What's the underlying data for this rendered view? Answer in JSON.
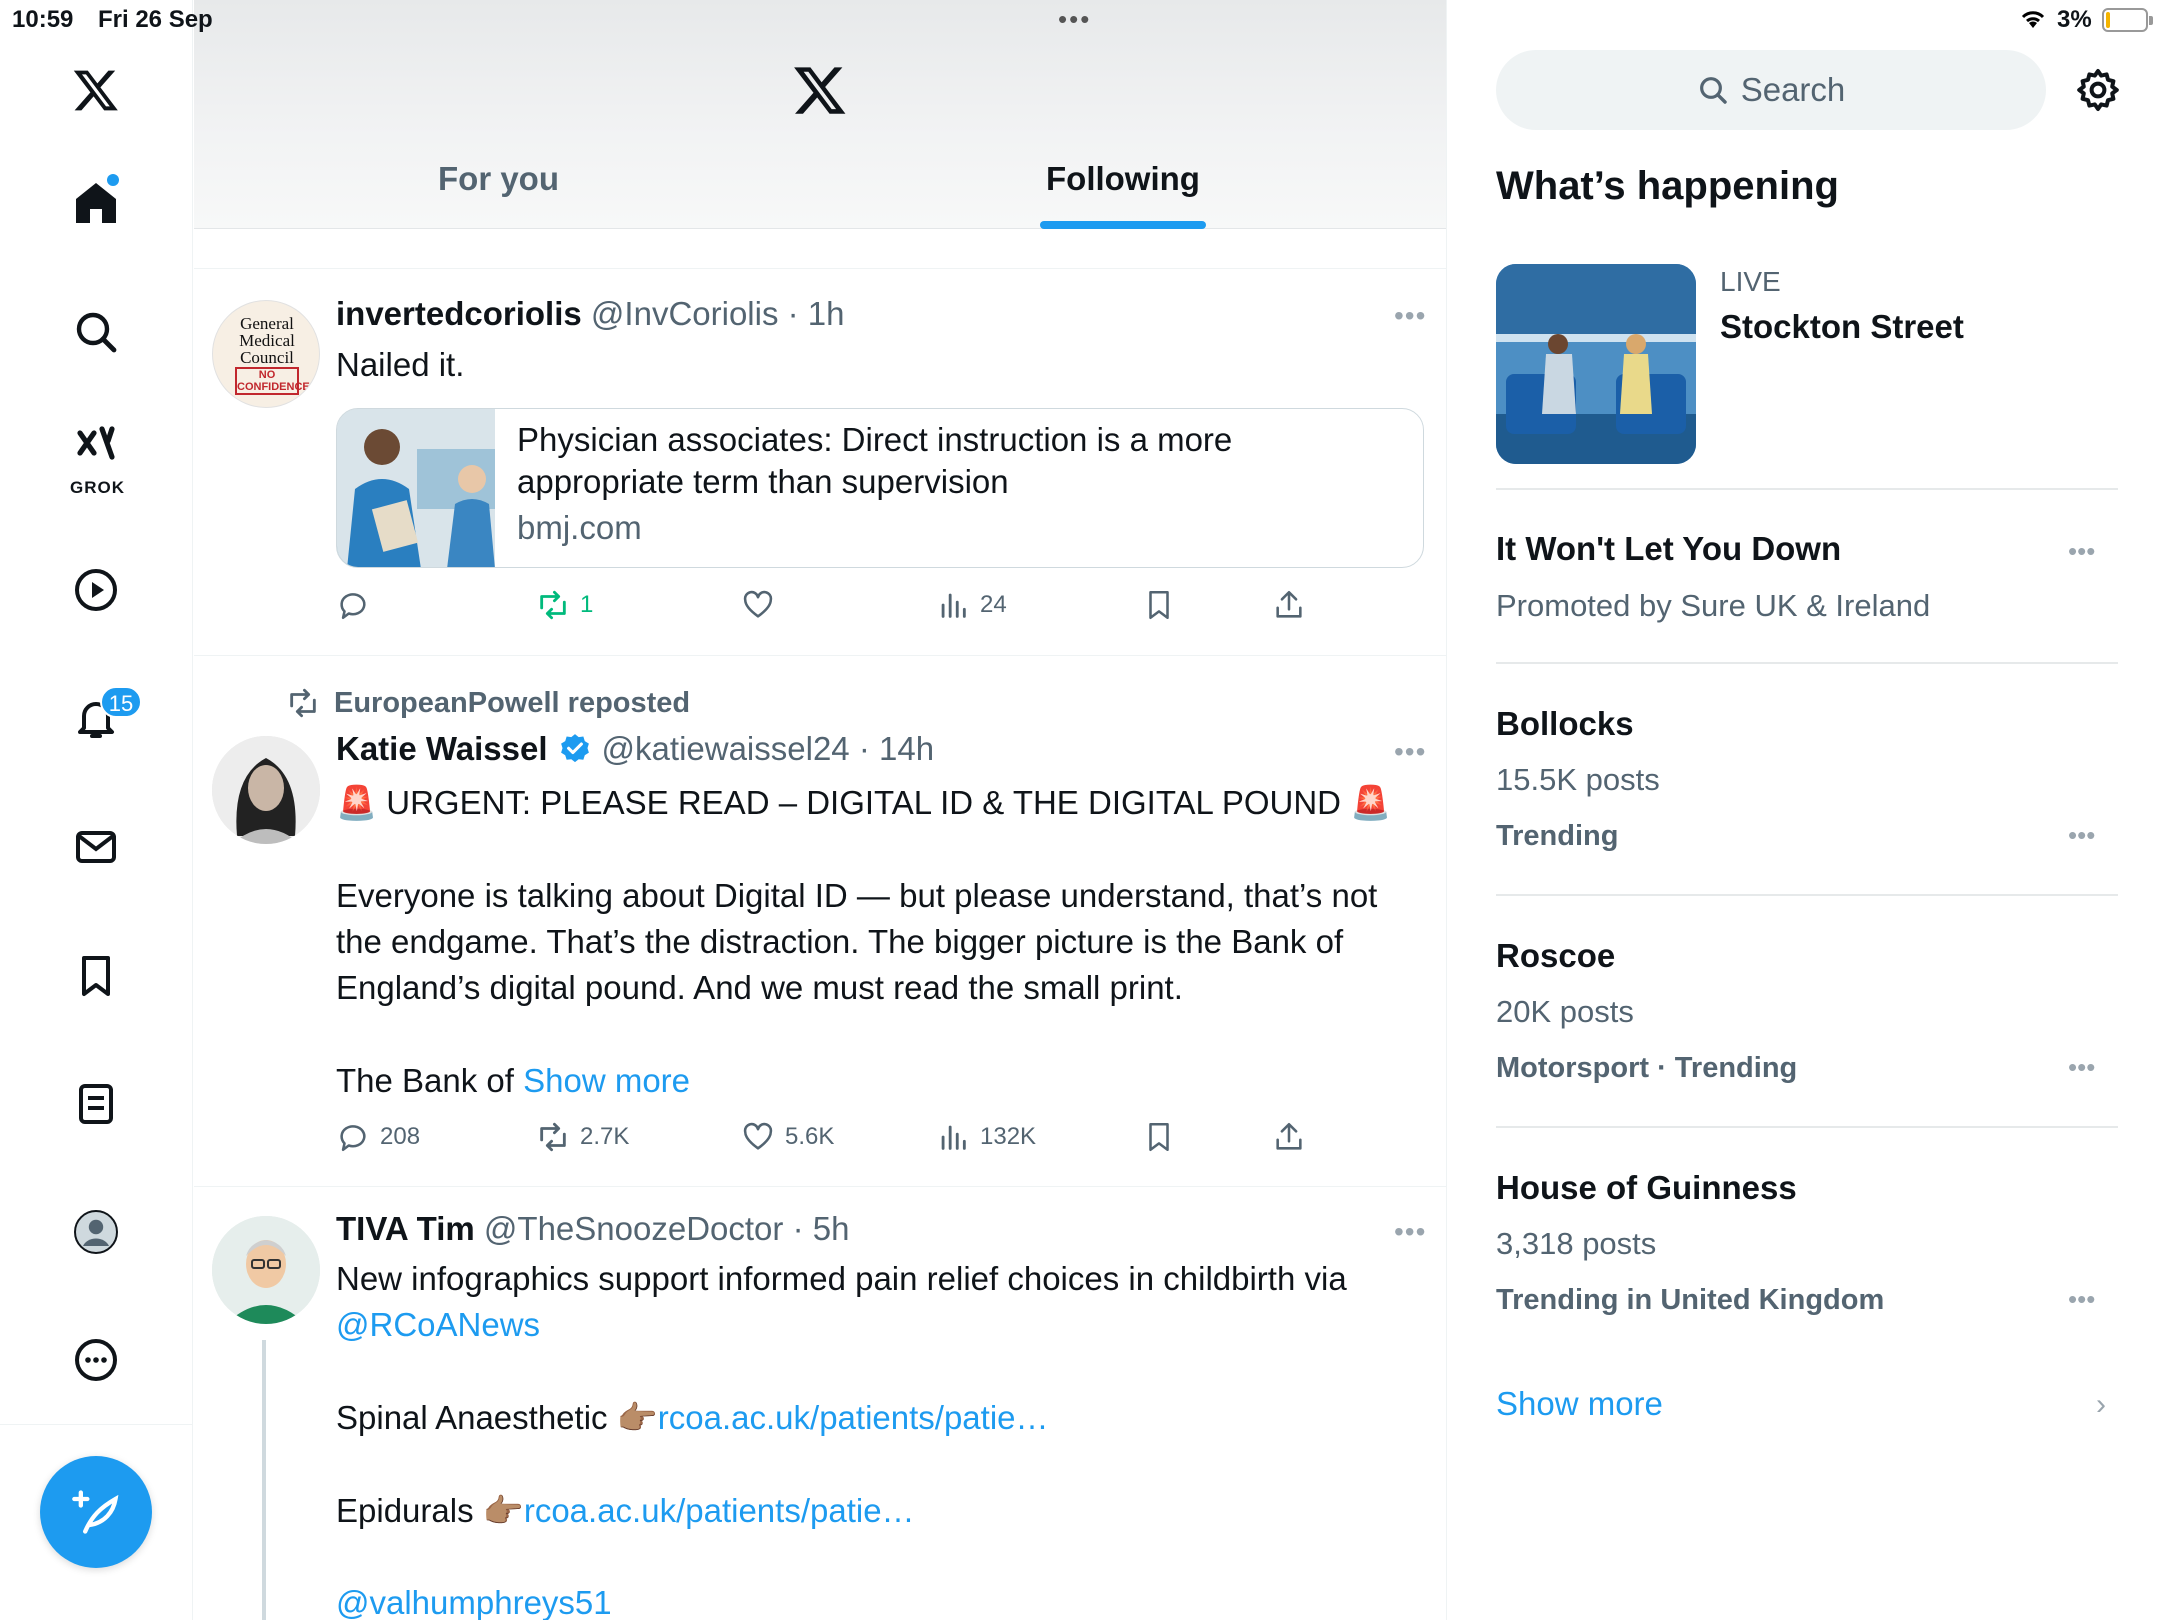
{
  "status": {
    "time": "10:59",
    "date": "Fri 26 Sep",
    "battery": "3%"
  },
  "nav": {
    "grok_label": "GROK",
    "notifications_badge": "15"
  },
  "tabs": {
    "for_you": "For you",
    "following": "Following"
  },
  "posts": [
    {
      "name": "invertedcoriolis",
      "meta": "@InvCoriolis · 1h",
      "text": "Nailed it.",
      "card": {
        "title": "Physician associates: Direct instruction is a more appropriate term than supervision",
        "domain": "bmj.com"
      },
      "avatar_text": {
        "l1": "General",
        "l2": "Medical",
        "l3": "Council",
        "l4": "NO",
        "l5": "CONFIDENCE"
      },
      "replies": "",
      "reposts": "1",
      "likes": "",
      "views": "24"
    },
    {
      "reposted_by": "EuropeanPowell reposted",
      "name": "Katie Waissel",
      "meta": "@katiewaissel24 · 14h",
      "headline": "🚨 URGENT: PLEASE READ – DIGITAL ID & THE DIGITAL POUND 🚨",
      "p1": "Everyone is talking about Digital ID — but please understand, that’s not",
      "p2": "the endgame. That’s the distraction. The bigger picture is the Bank of",
      "p3": "England’s digital pound. And we must read the small print.",
      "p4": "The Bank of ",
      "show_more": "Show more",
      "replies": "208",
      "reposts": "2.7K",
      "likes": "5.6K",
      "views": "132K"
    },
    {
      "name": "TIVA Tim",
      "meta": "@TheSnoozeDoctor · 5h",
      "l1": "New infographics support informed pain relief choices in childbirth via",
      "l2_link": "@RCoANews",
      "l3_text": "Spinal Anaesthetic 👉🏽",
      "l3_link": "rcoa.ac.uk/patients/patie…",
      "l4_text": "Epidurals 👉🏽",
      "l4_link": "rcoa.ac.uk/patients/patie…",
      "l5_link": "@valhumphreys51"
    }
  ],
  "right": {
    "search_placeholder": "Search",
    "whats_happening": "What’s happening",
    "live_label": "LIVE",
    "live_title": "Stockton Street",
    "trends": [
      {
        "title": "It Won't Let You Down",
        "sub": "Promoted by Sure UK & Ireland",
        "ctx": ""
      },
      {
        "title": "Bollocks",
        "sub": "15.5K posts",
        "ctx": "Trending"
      },
      {
        "title": "Roscoe",
        "sub": "20K posts",
        "ctx": "Motorsport · Trending"
      },
      {
        "title": "House of Guinness",
        "sub": "3,318 posts",
        "ctx": "Trending in United Kingdom"
      }
    ],
    "show_more": "Show more"
  },
  "colors": {
    "accent": "#1d9bf0",
    "repost_green": "#00ba7c",
    "text": "#0f1419",
    "muted": "#536471"
  }
}
